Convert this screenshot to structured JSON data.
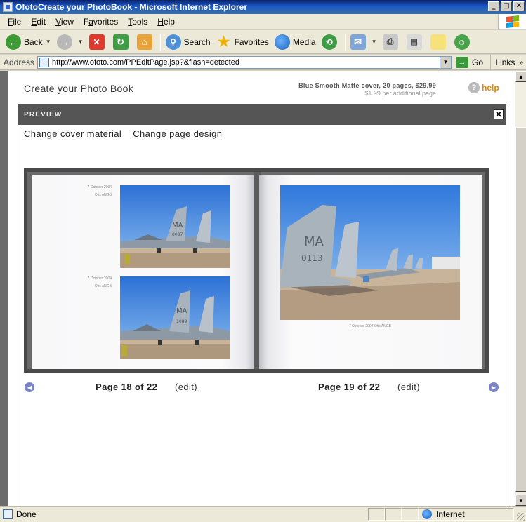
{
  "window": {
    "title": "OfotoCreate your PhotoBook - Microsoft Internet Explorer",
    "controls": {
      "minimize": "_",
      "maximize": "□",
      "close": "✕"
    }
  },
  "menu": [
    {
      "key": "F",
      "rest": "ile"
    },
    {
      "key": "E",
      "rest": "dit"
    },
    {
      "key": "V",
      "rest": "iew"
    },
    {
      "key": "F",
      "rest": "avorites",
      "pre": ""
    },
    {
      "key": "T",
      "rest": "ools"
    },
    {
      "key": "H",
      "rest": "elp"
    }
  ],
  "toolbar": {
    "back": "Back",
    "search": "Search",
    "favorites": "Favorites",
    "media": "Media"
  },
  "address": {
    "label": "Address",
    "url": "http://www.ofoto.com/PPEditPage.jsp?&flash=detected",
    "go": "Go",
    "links": "Links"
  },
  "page": {
    "title": "Create your Photo Book",
    "cover_line1": "Blue Smooth Matte cover, 20 pages, $29.99",
    "cover_line2": "$1.99 per additional page",
    "help": "help"
  },
  "preview": {
    "header": "PREVIEW",
    "close": "✕",
    "change_cover": "Change cover material",
    "change_design": "Change page design"
  },
  "book": {
    "left_captions": [
      {
        "date": "7 October 2004",
        "place": "Otis ANGB"
      },
      {
        "date": "7 October 2004",
        "place": "Otis ANGB"
      }
    ],
    "right_caption": "7 October 2004 Otis ANGB",
    "tail_letters": "MA",
    "tail_numbers": [
      "0087",
      "1089",
      "0113"
    ]
  },
  "navigation": {
    "left_page": "Page 18 of 22",
    "right_page": "Page 19 of 22",
    "edit": "(edit)"
  },
  "status": {
    "text": "Done",
    "zone": "Internet"
  },
  "colors": {
    "titlebar": "#0a246a",
    "panel_header": "#555555",
    "help_orange": "#e08a00",
    "nav_arrow": "#7a85c8"
  }
}
